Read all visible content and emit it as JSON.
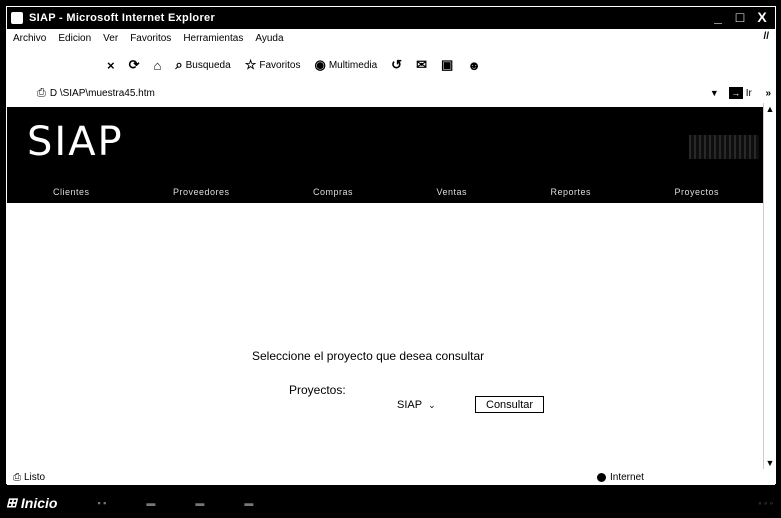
{
  "window": {
    "title": "SIAP - Microsoft Internet Explorer",
    "buttons": [
      "_",
      "□",
      "X"
    ]
  },
  "menubar": {
    "items": [
      "Archivo",
      "Edicion",
      "Ver",
      "Favoritos",
      "Herramientas",
      "Ayuda"
    ]
  },
  "toolbar": {
    "search_label": "Busqueda",
    "favorites_label": "Favoritos",
    "media_label": "Multimedia"
  },
  "addressbar": {
    "url": "D \\SIAP\\muestra45.htm",
    "go_label": "Ir"
  },
  "page": {
    "logo": "SIAP",
    "nav": [
      "Clientes",
      "Proveedores",
      "Compras",
      "Ventas",
      "Reportes",
      "Proyectos"
    ],
    "prompt": "Seleccione el proyecto que desea consultar",
    "projects_label": "Proyectos:",
    "selected_project": "SIAP",
    "consult_button": "Consultar"
  },
  "statusbar": {
    "status": "Listo",
    "zone": "Internet"
  },
  "taskbar": {
    "start_label": "Inicio"
  }
}
